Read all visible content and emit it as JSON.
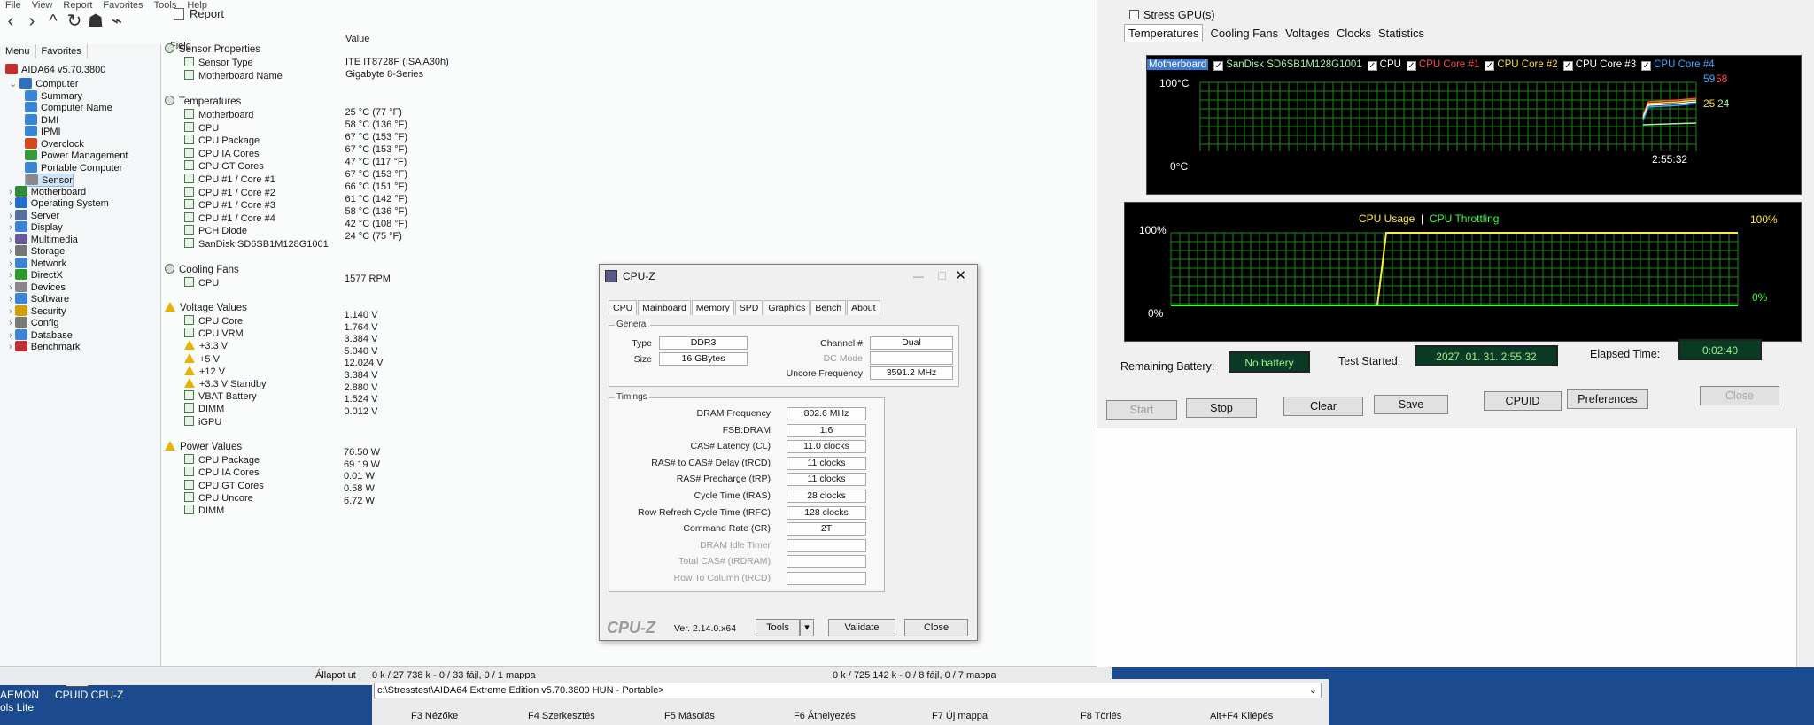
{
  "aida": {
    "menu": [
      "File",
      "View",
      "Report",
      "Favorites",
      "Tools",
      "Help"
    ],
    "report_label": "Report",
    "left_tabs": [
      "Menu",
      "Favorites"
    ],
    "version": "AIDA64 v5.70.3800",
    "tree": [
      {
        "label": "Computer",
        "level": 1,
        "color": "#2f6fbf"
      },
      {
        "label": "Summary",
        "level": 2,
        "color": "#3a86d4"
      },
      {
        "label": "Computer Name",
        "level": 2,
        "color": "#3a86d4"
      },
      {
        "label": "DMI",
        "level": 2,
        "color": "#3a86d4"
      },
      {
        "label": "IPMI",
        "level": 2,
        "color": "#3a86d4"
      },
      {
        "label": "Overclock",
        "level": 2,
        "color": "#d24a1c"
      },
      {
        "label": "Power Management",
        "level": 2,
        "color": "#3a9a3a"
      },
      {
        "label": "Portable Computer",
        "level": 2,
        "color": "#3a86d4"
      },
      {
        "label": "Sensor",
        "level": 2,
        "color": "#888888"
      },
      {
        "label": "Motherboard",
        "level": 1,
        "color": "#2f8a3a"
      },
      {
        "label": "Operating System",
        "level": 1,
        "color": "#1f6fd0"
      },
      {
        "label": "Server",
        "level": 1,
        "color": "#5570a0"
      },
      {
        "label": "Display",
        "level": 1,
        "color": "#3a86d4"
      },
      {
        "label": "Multimedia",
        "level": 1,
        "color": "#6a5a9a"
      },
      {
        "label": "Storage",
        "level": 1,
        "color": "#777777"
      },
      {
        "label": "Network",
        "level": 1,
        "color": "#3a86d4"
      },
      {
        "label": "DirectX",
        "level": 1,
        "color": "#2a9a2a"
      },
      {
        "label": "Devices",
        "level": 1,
        "color": "#888888"
      },
      {
        "label": "Software",
        "level": 1,
        "color": "#3a86d4"
      },
      {
        "label": "Security",
        "level": 1,
        "color": "#d4a000"
      },
      {
        "label": "Config",
        "level": 1,
        "color": "#7a7a7a"
      },
      {
        "label": "Database",
        "level": 1,
        "color": "#3a86d4"
      },
      {
        "label": "Benchmark",
        "level": 1,
        "color": "#c03030"
      }
    ],
    "col_field": "Field",
    "col_value": "Value",
    "sections": [
      {
        "title": "Sensor Properties",
        "icon": "sensor",
        "rows": [
          [
            "Sensor Type",
            "ITE IT8728F  (ISA A30h)"
          ],
          [
            "Motherboard Name",
            "Gigabyte 8-Series"
          ]
        ]
      },
      {
        "title": "Temperatures",
        "icon": "temp",
        "rows": [
          [
            "Motherboard",
            "25 °C  (77 °F)"
          ],
          [
            "CPU",
            "58 °C  (136 °F)"
          ],
          [
            "CPU Package",
            "67 °C  (153 °F)"
          ],
          [
            "CPU IA Cores",
            "67 °C  (153 °F)"
          ],
          [
            "CPU GT Cores",
            "47 °C  (117 °F)"
          ],
          [
            "CPU #1 / Core #1",
            "67 °C  (153 °F)"
          ],
          [
            "CPU #1 / Core #2",
            "66 °C  (151 °F)"
          ],
          [
            "CPU #1 / Core #3",
            "61 °C  (142 °F)"
          ],
          [
            "CPU #1 / Core #4",
            "58 °C  (136 °F)"
          ],
          [
            "PCH Diode",
            "42 °C  (108 °F)"
          ],
          [
            "SanDisk SD6SB1M128G1001",
            "24 °C  (75 °F)"
          ]
        ]
      },
      {
        "title": "Cooling Fans",
        "icon": "fan",
        "rows": [
          [
            "CPU",
            "1577 RPM"
          ]
        ]
      },
      {
        "title": "Voltage Values",
        "icon": "warn",
        "rows": [
          [
            "CPU Core",
            "1.140 V"
          ],
          [
            "CPU VRM",
            "1.764 V"
          ],
          [
            "+3.3 V",
            "3.384 V"
          ],
          [
            "+5 V",
            "5.040 V"
          ],
          [
            "+12 V",
            "12.024 V"
          ],
          [
            "+3.3 V Standby",
            "3.384 V"
          ],
          [
            "VBAT Battery",
            "2.880 V"
          ],
          [
            "DIMM",
            "1.524 V"
          ],
          [
            "iGPU",
            "0.012 V"
          ]
        ]
      },
      {
        "title": "Power Values",
        "icon": "warn",
        "rows": [
          [
            "CPU Package",
            "76.50 W"
          ],
          [
            "CPU IA Cores",
            "69.19 W"
          ],
          [
            "CPU GT Cores",
            "0.01 W"
          ],
          [
            "CPU Uncore",
            "0.58 W"
          ],
          [
            "DIMM",
            "6.72 W"
          ]
        ]
      }
    ],
    "status_left": "Állapot ut",
    "status_mid": "0 k / 27 738 k - 0 / 33 fájl, 0 / 1 mappa",
    "status_right": "0 k / 725 142 k - 0 / 8 fájl, 0 / 7 mappa"
  },
  "cpuz": {
    "title": "CPU-Z",
    "tabs": [
      "CPU",
      "Mainboard",
      "Memory",
      "SPD",
      "Graphics",
      "Bench",
      "About"
    ],
    "general_title": "General",
    "type_label": "Type",
    "type_value": "DDR3",
    "size_label": "Size",
    "size_value": "16 GBytes",
    "channel_label": "Channel #",
    "channel_value": "Dual",
    "dcmode_label": "DC Mode",
    "uncore_label": "Uncore Frequency",
    "uncore_value": "3591.2 MHz",
    "timings_title": "Timings",
    "timings": [
      {
        "label": "DRAM Frequency",
        "value": "802.6 MHz",
        "dim": false
      },
      {
        "label": "FSB:DRAM",
        "value": "1:6",
        "dim": false
      },
      {
        "label": "CAS# Latency (CL)",
        "value": "11.0 clocks",
        "dim": false
      },
      {
        "label": "RAS# to CAS# Delay (tRCD)",
        "value": "11 clocks",
        "dim": false
      },
      {
        "label": "RAS# Precharge (tRP)",
        "value": "11 clocks",
        "dim": false
      },
      {
        "label": "Cycle Time (tRAS)",
        "value": "28 clocks",
        "dim": false
      },
      {
        "label": "Row Refresh Cycle Time (tRFC)",
        "value": "128 clocks",
        "dim": false
      },
      {
        "label": "Command Rate (CR)",
        "value": "2T",
        "dim": false
      },
      {
        "label": "DRAM Idle Timer",
        "value": "",
        "dim": true
      },
      {
        "label": "Total CAS# (tRDRAM)",
        "value": "",
        "dim": true
      },
      {
        "label": "Row To Column (tRCD)",
        "value": "",
        "dim": true
      }
    ],
    "logo": "CPU-Z",
    "version": "Ver. 2.14.0.x64",
    "tools": "Tools",
    "validate": "Validate",
    "close": "Close"
  },
  "stability": {
    "stress_gpu": "Stress GPU(s)",
    "tabs": [
      "Temperatures",
      "Cooling Fans",
      "Voltages",
      "Clocks",
      "Statistics"
    ],
    "legend": [
      {
        "label": "Motherboard",
        "color": "#ffffff"
      },
      {
        "label": "SanDisk SD6SB1M128G1001",
        "color": "#a8f0a8"
      },
      {
        "label": "CPU",
        "color": "#ffffff"
      },
      {
        "label": "CPU Core #1",
        "color": "#ff4a4a"
      },
      {
        "label": "CPU Core #2",
        "color": "#ffdc3a"
      },
      {
        "label": "CPU Core #3",
        "color": "#ffffff"
      },
      {
        "label": "CPU Core #4",
        "color": "#3aa8ff"
      }
    ],
    "temp_top": "100°C",
    "temp_bottom": "0°C",
    "temp_time": "2:55:32",
    "temp_values": [
      "59",
      "58",
      "25",
      "24"
    ],
    "usage_label": "CPU Usage",
    "throttle_label": "CPU Throttling",
    "usage_top_left": "100%",
    "usage_bottom_left": "0%",
    "usage_top_right": "100%",
    "usage_bottom_right": "0%",
    "battery_label": "Remaining Battery:",
    "battery_value": "No battery",
    "started_label": "Test Started:",
    "started_value": "2027. 01. 31. 2:55:32",
    "elapsed_label": "Elapsed Time:",
    "elapsed_value": "0:02:40",
    "buttons": [
      "Start",
      "Stop",
      "Clear",
      "Save",
      "CPUID",
      "Preferences",
      "Close"
    ]
  },
  "taskbar": {
    "item1": "AEMON",
    "item1b": "ols Lite",
    "item2": "CPUID CPU-Z"
  },
  "commander": {
    "path": "c:\\Stresstest\\AIDA64 Extreme Edition v5.70.3800 HUN - Portable>",
    "fkeys": [
      "F3 Nézőke",
      "F4 Szerkesztés",
      "F5 Másolás",
      "F6 Áthelyezés",
      "F7 Új mappa",
      "F8 Törlés",
      "Alt+F4 Kilépés"
    ]
  }
}
